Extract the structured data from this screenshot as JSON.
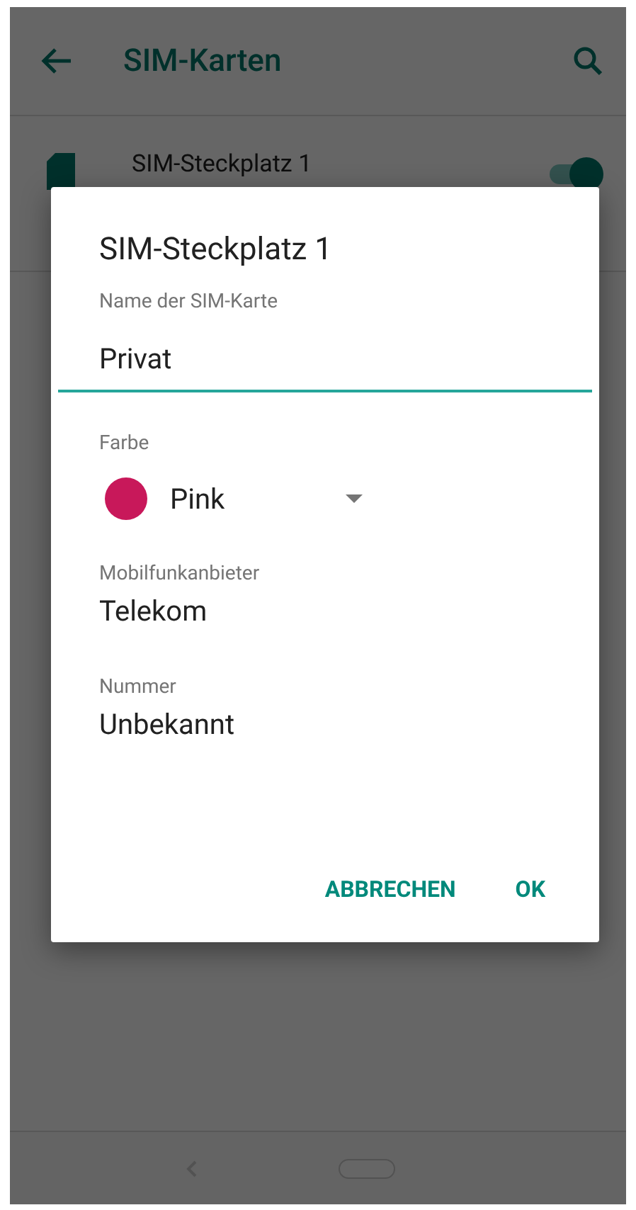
{
  "app_bar": {
    "title": "SIM-Karten"
  },
  "sim_slots": [
    {
      "name": "SIM-Steckplatz 1",
      "on": true
    }
  ],
  "dialog": {
    "title": "SIM-Steckplatz 1",
    "fields": [
      {
        "kind": "text_input",
        "label": "Name der SIM-Karte",
        "value": "Privat"
      },
      {
        "kind": "color_select",
        "label": "Farbe",
        "value": "Pink",
        "color": "#c8185a"
      },
      {
        "kind": "info",
        "label": "Mobilfunkanbieter",
        "value": "Telekom"
      },
      {
        "kind": "info",
        "label": "Nummer",
        "value": "Unbekannt"
      }
    ],
    "buttons": [
      "ABBRECHEN",
      "OK"
    ]
  }
}
